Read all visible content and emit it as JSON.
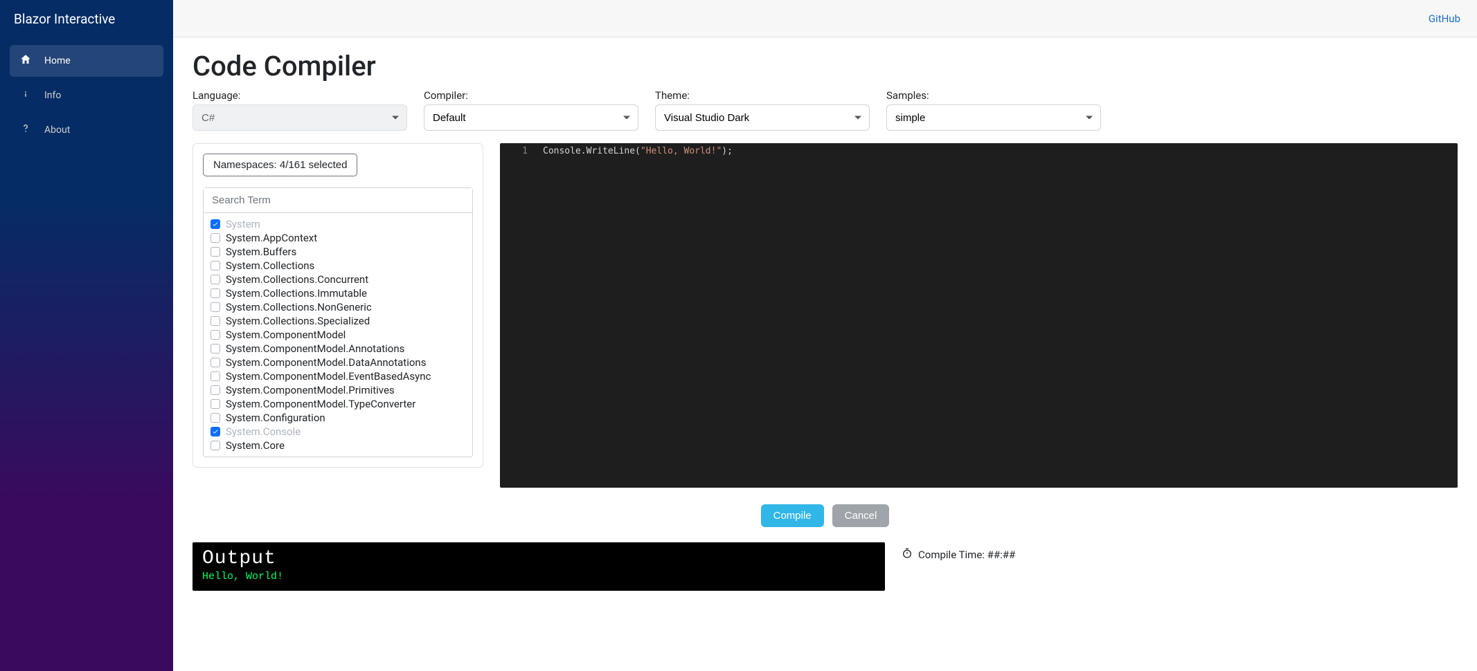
{
  "brand": "Blazor Interactive",
  "nav": {
    "home": "Home",
    "info": "Info",
    "about": "About"
  },
  "topbar": {
    "github": "GitHub"
  },
  "page": {
    "title": "Code Compiler"
  },
  "controls": {
    "language": {
      "label": "Language:",
      "value": "C#"
    },
    "compiler": {
      "label": "Compiler:",
      "value": "Default"
    },
    "theme": {
      "label": "Theme:",
      "value": "Visual Studio Dark"
    },
    "samples": {
      "label": "Samples:",
      "value": "simple"
    }
  },
  "namespaces": {
    "button": "Namespaces: 4/161 selected",
    "search_placeholder": "Search Term",
    "items": [
      {
        "name": "System",
        "checked": true
      },
      {
        "name": "System.AppContext",
        "checked": false
      },
      {
        "name": "System.Buffers",
        "checked": false
      },
      {
        "name": "System.Collections",
        "checked": false
      },
      {
        "name": "System.Collections.Concurrent",
        "checked": false
      },
      {
        "name": "System.Collections.Immutable",
        "checked": false
      },
      {
        "name": "System.Collections.NonGeneric",
        "checked": false
      },
      {
        "name": "System.Collections.Specialized",
        "checked": false
      },
      {
        "name": "System.ComponentModel",
        "checked": false
      },
      {
        "name": "System.ComponentModel.Annotations",
        "checked": false
      },
      {
        "name": "System.ComponentModel.DataAnnotations",
        "checked": false
      },
      {
        "name": "System.ComponentModel.EventBasedAsync",
        "checked": false
      },
      {
        "name": "System.ComponentModel.Primitives",
        "checked": false
      },
      {
        "name": "System.ComponentModel.TypeConverter",
        "checked": false
      },
      {
        "name": "System.Configuration",
        "checked": false
      },
      {
        "name": "System.Console",
        "checked": true
      },
      {
        "name": "System.Core",
        "checked": false
      }
    ]
  },
  "editor": {
    "line_no": "1",
    "pre": "Console.WriteLine(",
    "str": "\"Hello, World!\"",
    "post": ");"
  },
  "actions": {
    "compile": "Compile",
    "cancel": "Cancel"
  },
  "output": {
    "title": "Output",
    "body": "Hello, World!"
  },
  "compile_time": "Compile Time: ##:##"
}
